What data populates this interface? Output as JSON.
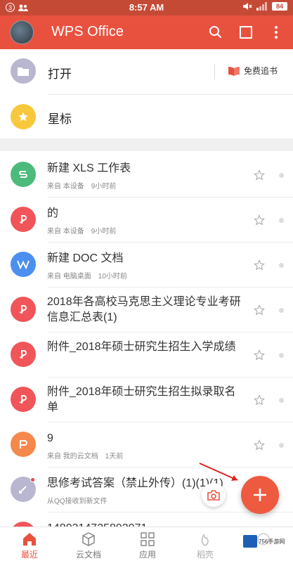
{
  "status_bar": {
    "notif_count": "3",
    "time": "8:57 AM",
    "battery": "84"
  },
  "app_bar": {
    "title": "WPS Office"
  },
  "quick": {
    "open_label": "打开",
    "star_label": "星标",
    "free_books_label": "免费追书"
  },
  "files": [
    {
      "title": "新建 XLS 工作表",
      "source": "来自 本设备",
      "time": "9小时前",
      "icon": "spreadsheet-icon",
      "color": "#4cba7b"
    },
    {
      "title": "的",
      "source": "来自 本设备",
      "time": "9小时前",
      "icon": "pdf-icon",
      "color": "#f0555a"
    },
    {
      "title": "新建 DOC 文档",
      "source": "来自 电脑桌面",
      "time": "10小时前",
      "icon": "word-icon",
      "color": "#4b8ff1"
    },
    {
      "title": "2018年各高校马克思主义理论专业考研信息汇总表(1)",
      "source": "",
      "time": "",
      "icon": "pdf-icon",
      "color": "#f0555a"
    },
    {
      "title": "附件_2018年硕士研究生招生入学成绩",
      "source": "",
      "time": "",
      "icon": "pdf-icon",
      "color": "#f0555a"
    },
    {
      "title": "附件_2018年硕士研究生招生拟录取名单",
      "source": "",
      "time": "",
      "icon": "pdf-icon",
      "color": "#f0555a"
    },
    {
      "title": "9",
      "source": "来自 我的云文档",
      "time": "1天前",
      "icon": "presentation-icon",
      "color": "#f5894c"
    },
    {
      "title": "思修考试答案（禁止外传）(1)(1)(1)",
      "source": "从QQ接收到新文件",
      "time": "",
      "icon": "qq-file-icon",
      "color": "#b8b6d0"
    },
    {
      "title": "1480314725892071",
      "source": "",
      "time": "",
      "icon": "pdf-icon",
      "color": "#f0555a"
    }
  ],
  "nav": [
    {
      "label": "最近",
      "icon": "home-icon"
    },
    {
      "label": "云文档",
      "icon": "cloud-doc-icon"
    },
    {
      "label": "应用",
      "icon": "apps-icon"
    },
    {
      "label": "稻壳",
      "icon": "docer-icon"
    },
    {
      "label": "",
      "icon": "more-icon"
    }
  ],
  "watermark": {
    "text": "756手游网"
  },
  "colors": {
    "accent": "#e9513f",
    "status_bar": "#c54a36"
  }
}
